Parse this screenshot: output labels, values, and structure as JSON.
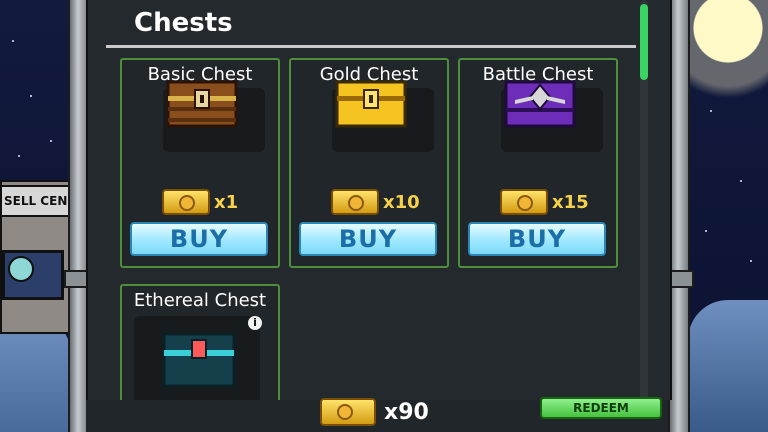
{
  "title": "Chests",
  "chests": [
    {
      "name": "Basic Chest",
      "price": "x1",
      "buy_label": "BUY",
      "icon": "basic-chest-icon"
    },
    {
      "name": "Gold Chest",
      "price": "x10",
      "buy_label": "BUY",
      "icon": "gold-chest-icon"
    },
    {
      "name": "Battle Chest",
      "price": "x15",
      "buy_label": "BUY",
      "icon": "battle-chest-icon"
    },
    {
      "name": "Ethereal Chest",
      "icon": "ethereal-chest-icon"
    }
  ],
  "wallet": {
    "amount": "x90"
  },
  "redeem_label": "REDEEM",
  "background": {
    "sell_sign": "SELL CEN"
  },
  "colors": {
    "accent_green": "#3ad364",
    "price_gold": "#f6d14a",
    "buy_blue": "#7cdaf7"
  }
}
